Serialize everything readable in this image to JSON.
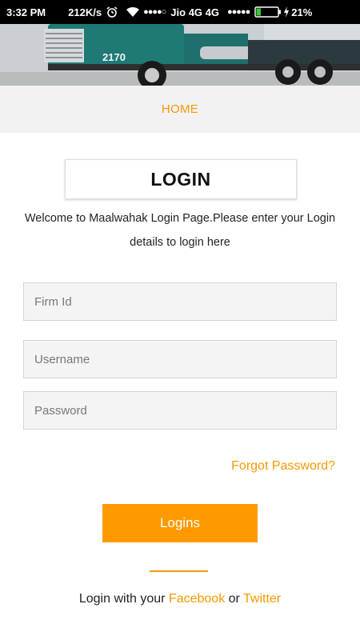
{
  "status_bar": {
    "time": "3:32 PM",
    "net_speed": "212K/s",
    "signal_dots_1": "●●●●○",
    "carrier": "Jio 4G 4G",
    "signal_dots_2": "●●●●●",
    "battery_percent": "21%",
    "battery_level": 0.21
  },
  "nav": {
    "home_label": "HOME"
  },
  "login": {
    "title": "LOGIN",
    "welcome_line1": "Welcome to Maalwahak Login Page.Please enter your Login",
    "welcome_line2": "details to login here",
    "firm_placeholder": "Firm Id",
    "username_placeholder": "Username",
    "password_placeholder": "Password",
    "forgot_label": "Forgot Password?",
    "submit_label": "Logins"
  },
  "social": {
    "prefix": "Login with your ",
    "facebook_label": "Facebook",
    "middle": " or ",
    "twitter_label": "Twitter"
  },
  "colors": {
    "accent": "#f59a00",
    "button": "#ff9900",
    "nav_bg": "#f2f2f2",
    "field_bg": "#f4f4f4"
  },
  "icons": [
    "alarm-icon",
    "wifi-icon",
    "battery-icon",
    "charging-bolt-icon"
  ]
}
